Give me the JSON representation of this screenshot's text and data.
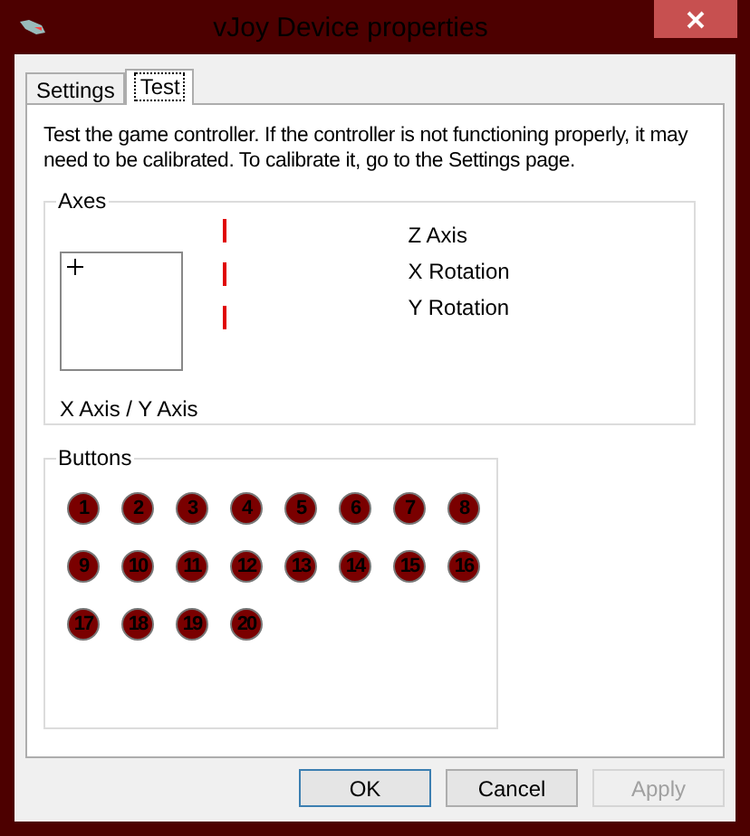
{
  "window": {
    "title": "vJoy Device properties"
  },
  "tabs": [
    {
      "label": "Settings",
      "selected": false
    },
    {
      "label": "Test",
      "selected": true
    }
  ],
  "description": "Test the game controller.  If the controller is not functioning properly, it may need to be calibrated.  To calibrate it, go to the Settings page.",
  "axes": {
    "title": "Axes",
    "xy_label": "X Axis / Y Axis",
    "items": [
      {
        "label": "Z Axis"
      },
      {
        "label": "X Rotation"
      },
      {
        "label": "Y Rotation"
      }
    ]
  },
  "buttons_group": {
    "title": "Buttons",
    "items": [
      "1",
      "2",
      "3",
      "4",
      "5",
      "6",
      "7",
      "8",
      "9",
      "10",
      "11",
      "12",
      "13",
      "14",
      "15",
      "16",
      "17",
      "18",
      "19",
      "20"
    ]
  },
  "dialog_buttons": [
    {
      "label": "OK",
      "default": true,
      "disabled": false
    },
    {
      "label": "Cancel",
      "default": false,
      "disabled": false
    },
    {
      "label": "Apply",
      "default": false,
      "disabled": true
    }
  ]
}
